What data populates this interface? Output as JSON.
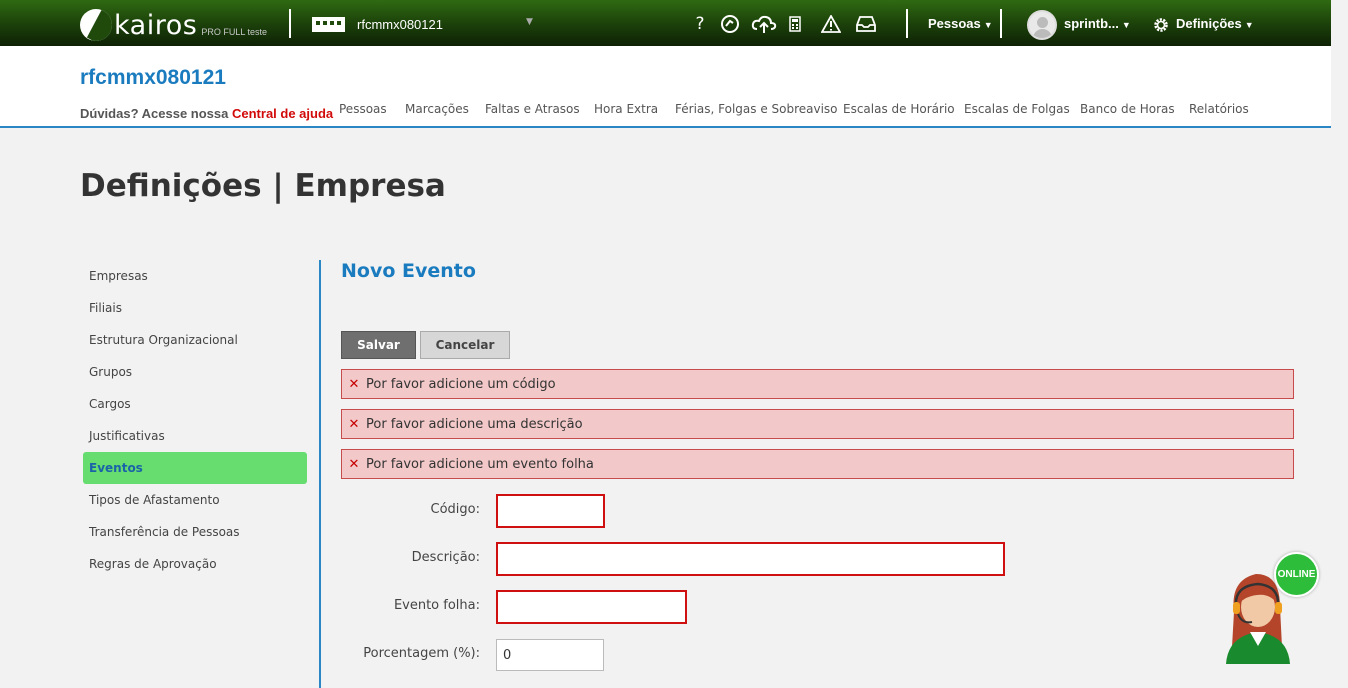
{
  "topbar": {
    "logo_text": "kairos",
    "logo_sub": "PRO FULL teste",
    "company_name": "rfcmmx080121",
    "pessoas_label": "Pessoas",
    "user_label": "sprintb...",
    "definicoes_label": "Definições"
  },
  "header": {
    "company_title": "rfcmmx080121",
    "help_text": "Dúvidas? Acesse nossa",
    "help_link": "Central de ajuda",
    "nav": [
      "Pessoas",
      "Marcações",
      "Faltas e Atrasos",
      "Hora Extra",
      "Férias, Folgas e Sobreaviso",
      "Escalas de Horário",
      "Escalas de Folgas",
      "Banco de Horas",
      "Relatórios"
    ]
  },
  "page_title": "Definições | Empresa",
  "sidebar": {
    "items": [
      "Empresas",
      "Filiais",
      "Estrutura Organizacional",
      "Grupos",
      "Cargos",
      "Justificativas",
      "Eventos",
      "Tipos de Afastamento",
      "Transferência de Pessoas",
      "Regras de Aprovação"
    ],
    "active": "Eventos"
  },
  "main": {
    "title": "Novo Evento",
    "save_label": "Salvar",
    "cancel_label": "Cancelar",
    "errors": [
      "Por favor adicione um código",
      "Por favor adicione uma descrição",
      "Por favor adicione um evento folha"
    ],
    "fields": {
      "codigo_label": "Código:",
      "codigo_value": "",
      "descricao_label": "Descrição:",
      "descricao_value": "",
      "evento_folha_label": "Evento folha:",
      "evento_folha_value": "",
      "porcentagem_label": "Porcentagem (%):",
      "porcentagem_value": "0"
    }
  },
  "chat": {
    "badge": "ONLINE"
  },
  "colors": {
    "accent": "#1a7bbf",
    "active_item": "#67dc6f",
    "error_bg": "#f2c8c8",
    "error_border": "#cf1010",
    "topbar": "#1b3f0a"
  },
  "icons": [
    "help-icon",
    "support-icon",
    "cloud-upload-icon",
    "calculator-icon",
    "warning-icon",
    "inbox-icon",
    "gear-icon"
  ]
}
